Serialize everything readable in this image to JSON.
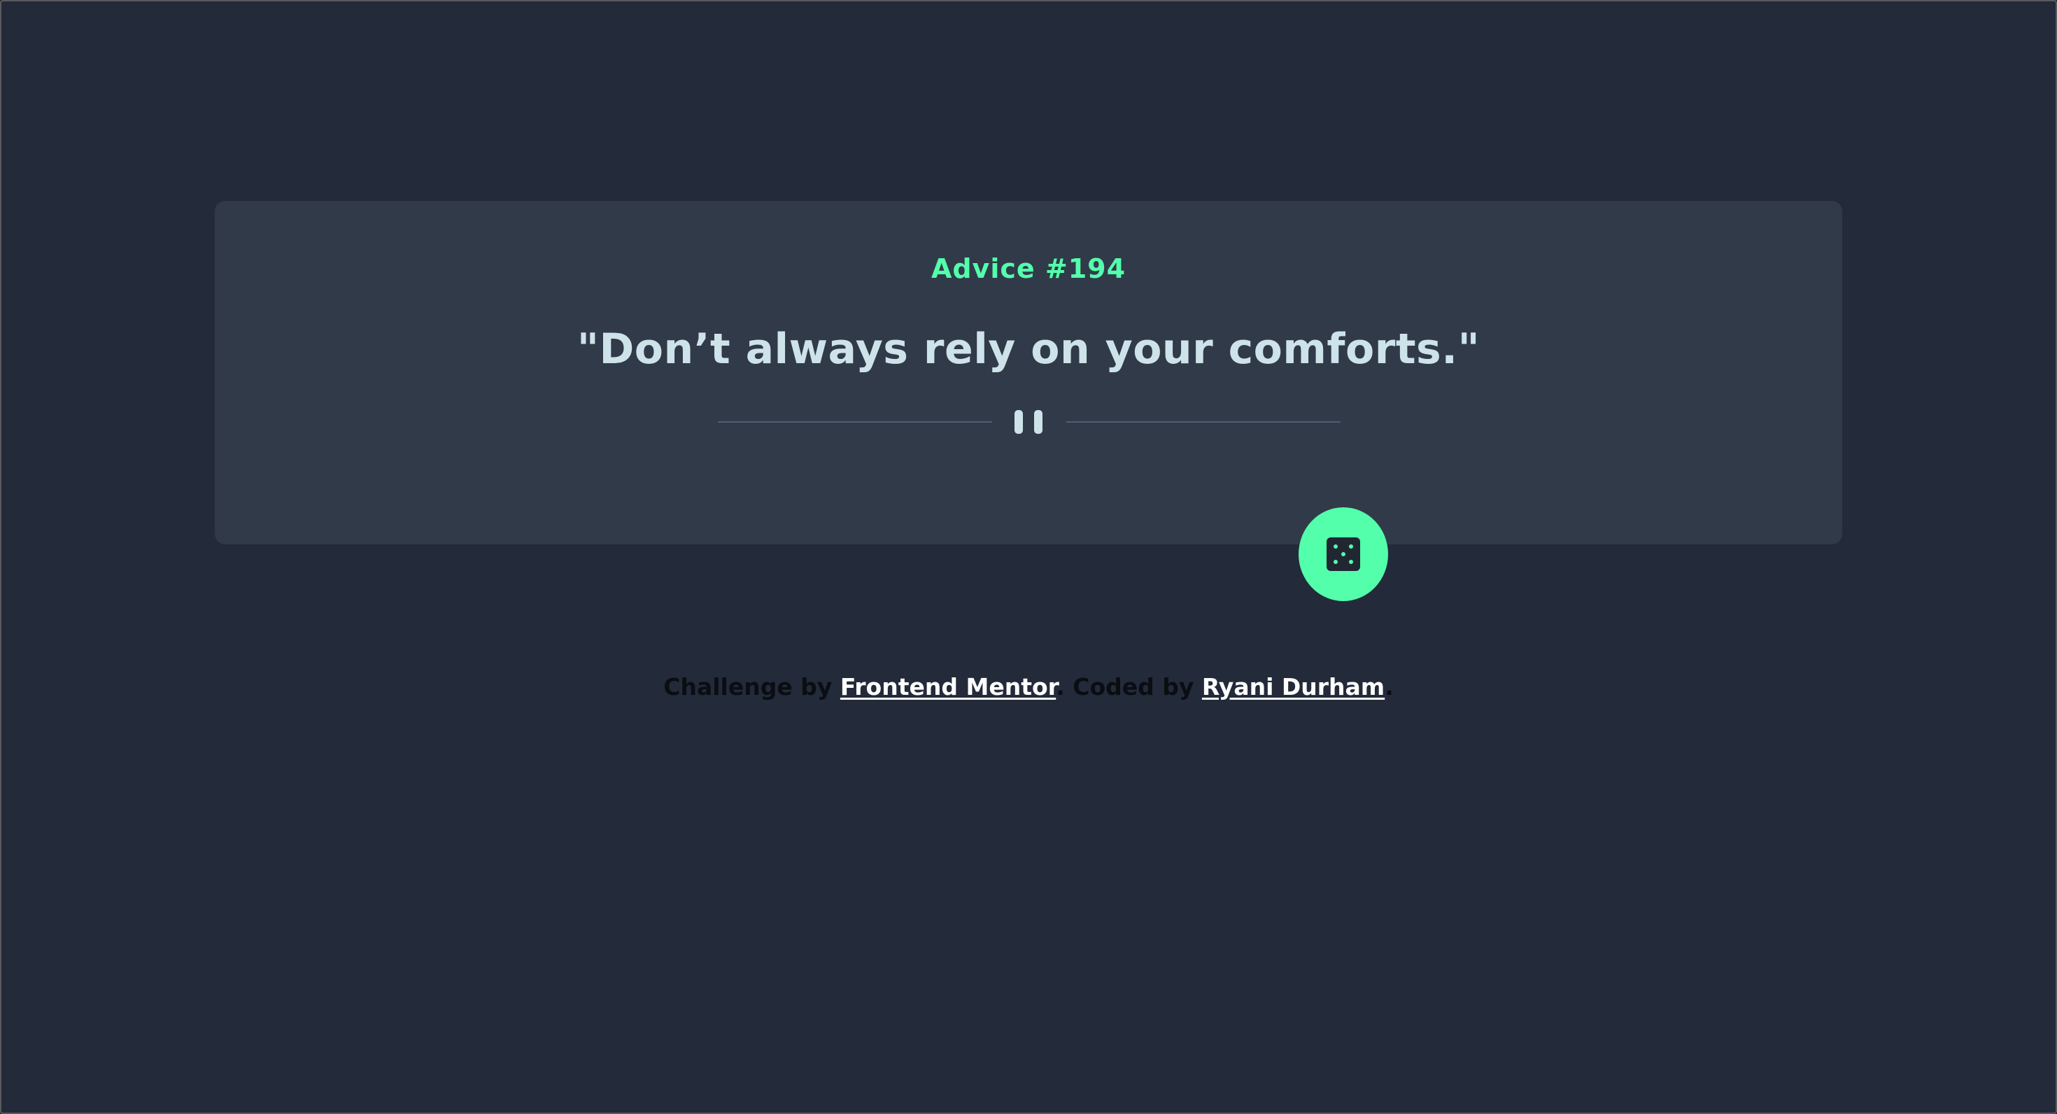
{
  "advice": {
    "label": "Advice #194",
    "text": "\"Don’t always rely on your comforts.\""
  },
  "controls": {
    "dice_icon": "dice-icon"
  },
  "attribution": {
    "prefix": "Challenge by ",
    "frontend_mentor": "Frontend Mentor",
    "middle": ". Coded by ",
    "author": "Ryani Durham",
    "suffix": "."
  },
  "colors": {
    "background": "#202632",
    "card": "#313a49",
    "accent": "#53ffab",
    "text": "#cee3e9"
  }
}
